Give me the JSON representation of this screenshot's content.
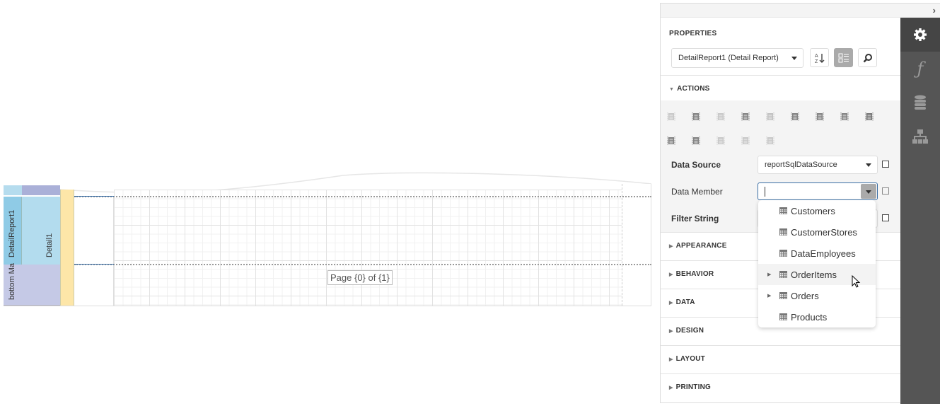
{
  "designer": {
    "bands": {
      "detail_report": "DetailReport1",
      "detail": "Detail1",
      "bottom_margin": "bottom Ma"
    },
    "page_label": "Page {0} of {1}"
  },
  "panel": {
    "title": "PROPERTIES",
    "component_selector": "DetailReport1 (Detail Report)",
    "toolbar": {
      "sort_icon": "sort-alpha-icon",
      "categories_icon": "categories-icon",
      "search_icon": "search-icon"
    },
    "sidetabs": [
      {
        "name": "properties",
        "icon": "gear-icon",
        "active": true
      },
      {
        "name": "expressions",
        "icon": "function-icon",
        "active": false
      },
      {
        "name": "field-list",
        "icon": "database-icon",
        "active": false
      },
      {
        "name": "report-explorer",
        "icon": "hierarchy-icon",
        "active": false
      }
    ],
    "actions": {
      "label": "ACTIONS",
      "expanded": true
    },
    "properties": [
      {
        "label": "Data Source",
        "value": "reportSqlDataSource",
        "bold": true
      },
      {
        "label": "Data Member",
        "value": "",
        "bold": false
      },
      {
        "label": "Filter String",
        "value": "",
        "bold": true
      }
    ],
    "sections": [
      "APPEARANCE",
      "BEHAVIOR",
      "DATA",
      "DESIGN",
      "LAYOUT",
      "PRINTING"
    ]
  },
  "dropdown": {
    "items": [
      {
        "label": "Customers",
        "expandable": false
      },
      {
        "label": "CustomerStores",
        "expandable": false
      },
      {
        "label": "DataEmployees",
        "expandable": false
      },
      {
        "label": "OrderItems",
        "expandable": true,
        "hover": true
      },
      {
        "label": "Orders",
        "expandable": true
      },
      {
        "label": "Products",
        "expandable": false
      }
    ]
  },
  "colors": {
    "accent": "#3a6ea5",
    "sidebar": "#555555",
    "sidebar_active": "#454545",
    "detail_report_band": "#8fcbe6",
    "detail_band": "#b3dcee",
    "margin_band": "#c5c9e6",
    "ruler": "#fde6a8"
  }
}
